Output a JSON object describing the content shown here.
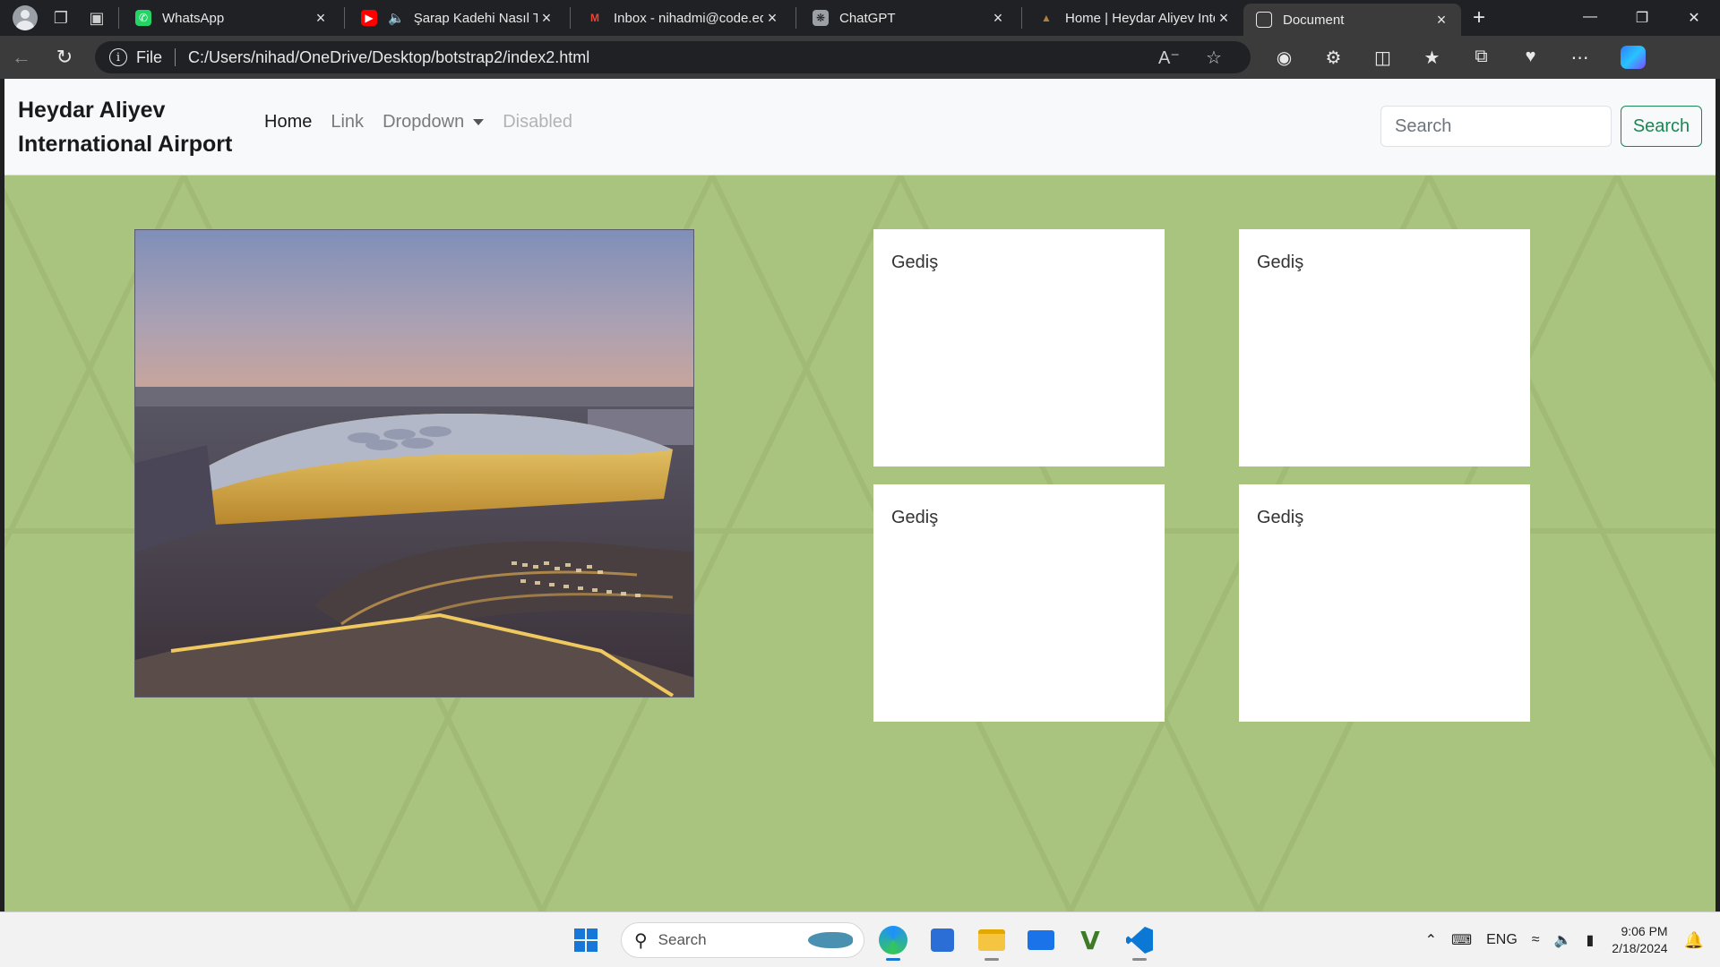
{
  "browser": {
    "tabs": [
      {
        "title": "WhatsApp",
        "icon": "whatsapp-icon",
        "active": false
      },
      {
        "title": "Şarap Kadehi Nasıl Tutulur",
        "icon": "youtube-icon",
        "audio": true,
        "active": false
      },
      {
        "title": "Inbox - nihadmi@code.edu.az",
        "icon": "gmail-icon",
        "active": false
      },
      {
        "title": "ChatGPT",
        "icon": "chatgpt-icon",
        "active": false
      },
      {
        "title": "Home | Heydar Aliyev International Airport",
        "icon": "airport-icon",
        "active": false
      },
      {
        "title": "Document",
        "icon": "document-icon",
        "active": true
      }
    ],
    "address": {
      "scheme_label": "File",
      "url": "C:/Users/nihad/OneDrive/Desktop/botstrap2/index2.html"
    }
  },
  "page": {
    "brand": "Heydar Aliyev International Airport",
    "nav": [
      {
        "label": "Home",
        "state": "active"
      },
      {
        "label": "Link",
        "state": "normal"
      },
      {
        "label": "Dropdown",
        "state": "dropdown"
      },
      {
        "label": "Disabled",
        "state": "disabled"
      }
    ],
    "search": {
      "placeholder": "Search",
      "button_label": "Search"
    },
    "background_color": "#a9c47f",
    "button_color": "#198754",
    "hero_image": "airport-terminal-photo",
    "cards": [
      {
        "title": "Gediş"
      },
      {
        "title": "Gediş"
      },
      {
        "title": "Gediş"
      },
      {
        "title": "Gediş"
      }
    ]
  },
  "taskbar": {
    "search_placeholder": "Search",
    "apps": [
      "start-icon",
      "edge-icon",
      "microsoft-store-icon",
      "file-explorer-icon",
      "mail-icon",
      "vim-icon",
      "vscode-icon"
    ],
    "tray": {
      "language": "ENG",
      "time": "9:06 PM",
      "date": "2/18/2024"
    }
  }
}
